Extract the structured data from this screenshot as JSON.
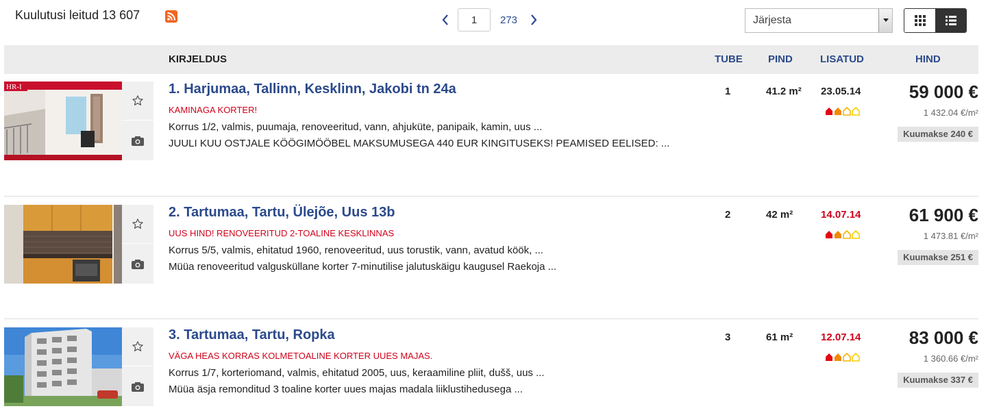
{
  "header": {
    "found_label": "Kuulutusi leitud 13 607",
    "page_current": "1",
    "page_total": "273",
    "sort_label": "Järjesta"
  },
  "columns": {
    "description": "KIRJELDUS",
    "rooms": "TUBE",
    "area": "PIND",
    "added": "LISATUD",
    "price": "HIND"
  },
  "listings": [
    {
      "title": "1. Harjumaa, Tallinn, Kesklinn, Jakobi tn 24a",
      "tagline": "KAMINAGA KORTER!",
      "line1": "Korrus 1/2, valmis, puumaja, renoveeritud, vann, ahjuküte, panipaik, kamin, uus ...",
      "line2": "JUULI KUU OSTJALE KÖÖGIMÖÖBEL MAKSUMUSEGA 440 EUR KINGITUSEKS! PEAMISED EELISED: ...",
      "rooms": "1",
      "area": "41.2 m²",
      "date": "23.05.14",
      "price": "59 000 €",
      "price_per_m2": "1 432.04 €/m²",
      "monthly": "Kuumakse 240 €",
      "thumb_logo": "HR-I"
    },
    {
      "title": "2. Tartumaa, Tartu, Ülejõe, Uus 13b",
      "tagline": "UUS HIND! RENOVEERITUD 2-TOALINE KESKLINNAS",
      "line1": "Korrus 5/5, valmis, ehitatud 1960, renoveeritud, uus torustik, vann, avatud köök, ...",
      "line2": "Müüa renoveeritud valgusküllane korter 7-minutilise jalutuskäigu kaugusel Raekoja ...",
      "rooms": "2",
      "area": "42 m²",
      "date": "14.07.14",
      "price": "61 900 €",
      "price_per_m2": "1 473.81 €/m²",
      "monthly": "Kuumakse 251 €"
    },
    {
      "title": "3. Tartumaa, Tartu, Ropka",
      "tagline": "VÄGA HEAS KORRAS KOLMETOALINE KORTER UUES MAJAS.",
      "line1": "Korrus 1/7, korteriomand, valmis, ehitatud 2005, uus, keraamiline pliit, dušš, uus ...",
      "line2": "Müüa äsja remonditud 3 toaline korter uues majas madala liiklustihedusega ...",
      "rooms": "3",
      "area": "61 m²",
      "date": "12.07.14",
      "price": "83 000 €",
      "price_per_m2": "1 360.66 €/m²",
      "monthly": "Kuumakse 337 €"
    }
  ],
  "colors": {
    "link_blue": "#2b4a8b",
    "accent_red": "#d0021b",
    "rss_orange": "#f26522"
  },
  "icons": [
    "rss-icon",
    "chevron-left-icon",
    "chevron-right-icon",
    "dropdown-arrow-icon",
    "grid-view-icon",
    "list-view-icon",
    "star-icon",
    "camera-icon",
    "energy-house-icon"
  ]
}
